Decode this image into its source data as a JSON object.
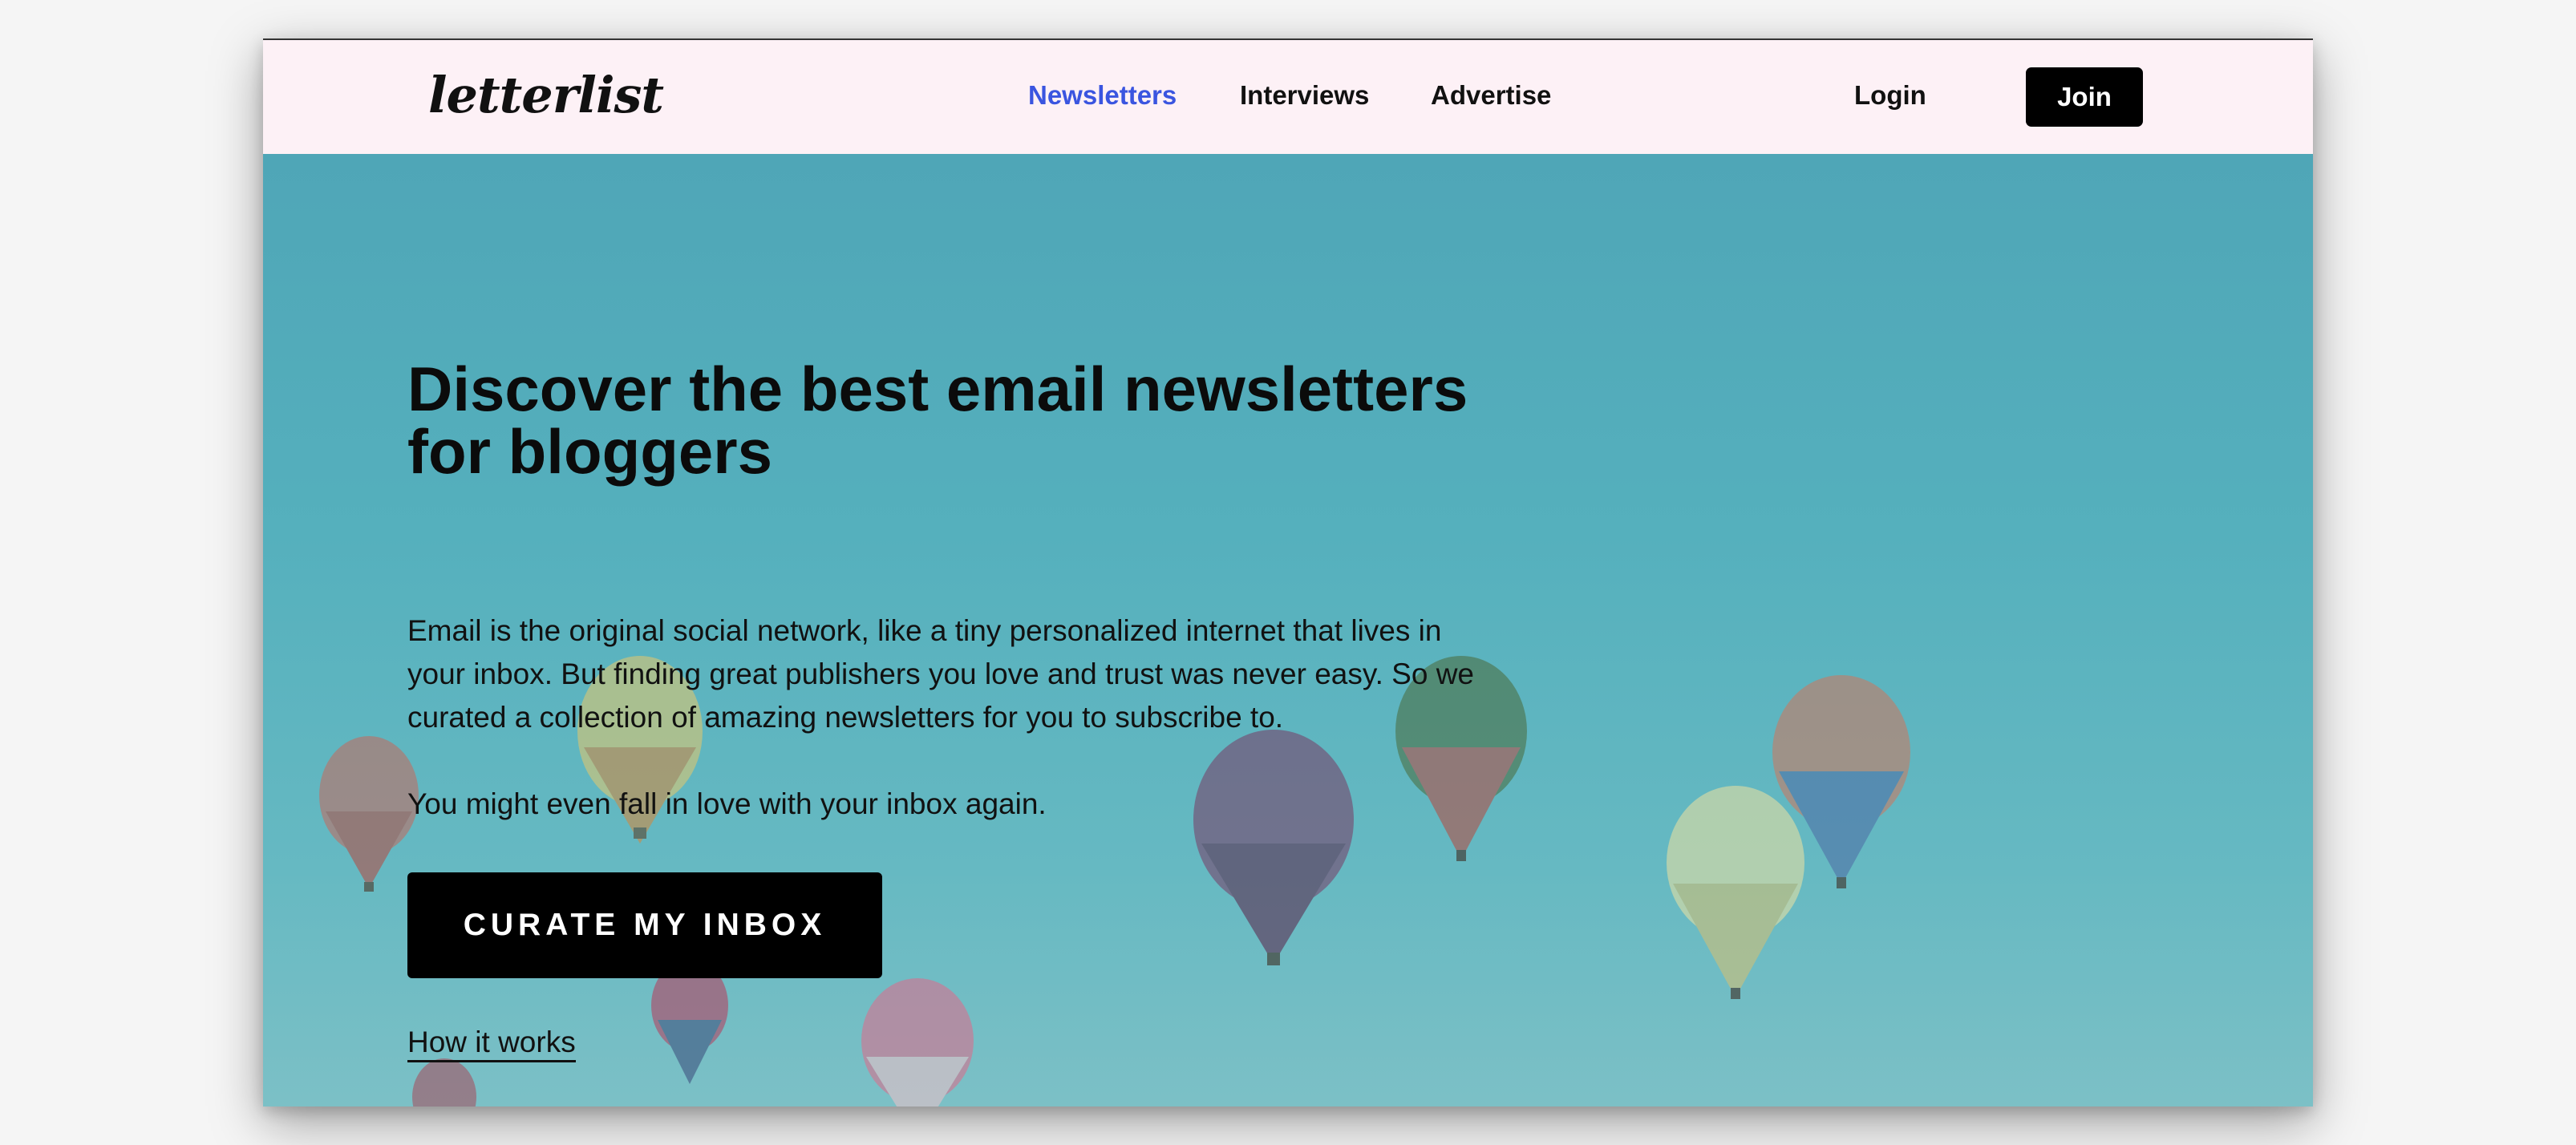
{
  "header": {
    "logo": "letterlist",
    "nav": [
      {
        "label": "Newsletters",
        "active": true
      },
      {
        "label": "Interviews",
        "active": false
      },
      {
        "label": "Advertise",
        "active": false
      }
    ],
    "login_label": "Login",
    "join_label": "Join"
  },
  "hero": {
    "headline": "Discover the best email newsletters for bloggers",
    "intro": "Email is the original social network, like a tiny personalized internet that lives in your inbox. But finding great publishers you love and trust was never easy. So we curated a collection of amazing newsletters for you to subscribe to.",
    "tagline": "You might even fall in love with your inbox again.",
    "cta_label": "CURATE MY INBOX",
    "how_link": "How it works"
  },
  "colors": {
    "header_bg": "#fdf1f6",
    "nav_active": "#3a55e0",
    "button_bg": "#000000",
    "hero_sky": "#55b0bd"
  }
}
